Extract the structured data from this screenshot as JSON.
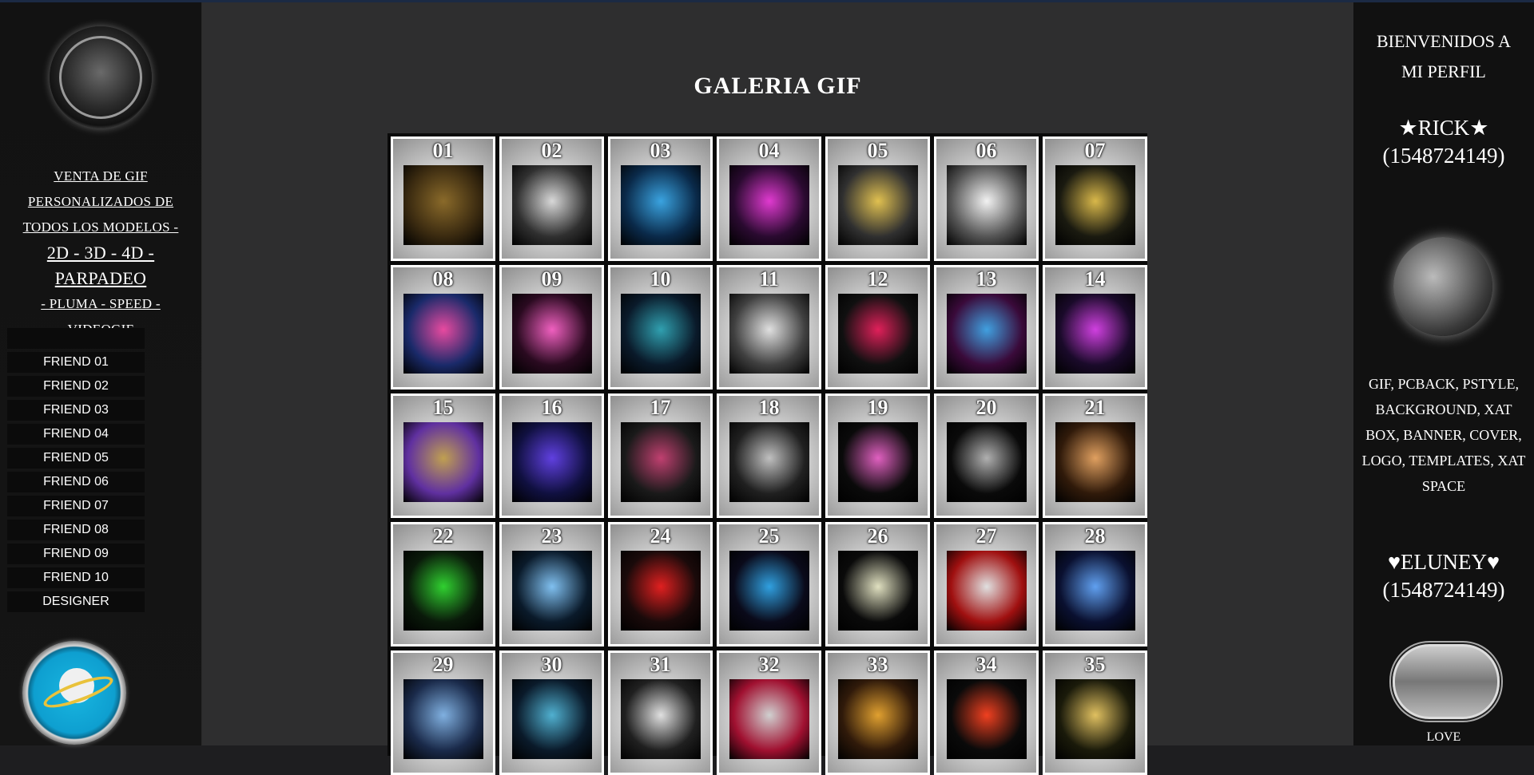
{
  "left": {
    "logo_icon": "rick-logo-icon",
    "promo": {
      "line1": "VENTA DE GIF",
      "line2": "PERSONALIZADOS DE",
      "line3": "TODOS LOS MODELOS -",
      "line4": "2D - 3D - 4D - PARPADEO",
      "line5": "- PLUMA - SPEED -",
      "line6": "VIDEOGIF"
    },
    "friends": [
      "FRIEND 01",
      "FRIEND 02",
      "FRIEND 03",
      "FRIEND 04",
      "FRIEND 05",
      "FRIEND 06",
      "FRIEND 07",
      "FRIEND 08",
      "FRIEND 09",
      "FRIEND 10",
      "DESIGNER"
    ],
    "bottom_icon": "saturn-icon"
  },
  "main": {
    "title": "GALERIA GIF",
    "tiles": [
      {
        "num": "01",
        "colors": [
          "#8a6a2a",
          "#3a2a10"
        ]
      },
      {
        "num": "02",
        "colors": [
          "#d8d8d8",
          "#303030"
        ]
      },
      {
        "num": "03",
        "colors": [
          "#3aa3e0",
          "#0a2a4a"
        ]
      },
      {
        "num": "04",
        "colors": [
          "#e03ad0",
          "#2a0a30"
        ]
      },
      {
        "num": "05",
        "colors": [
          "#e0c050",
          "#303030"
        ]
      },
      {
        "num": "06",
        "colors": [
          "#f2f2f2",
          "#555555"
        ]
      },
      {
        "num": "07",
        "colors": [
          "#d9b84a",
          "#1a1a10"
        ]
      },
      {
        "num": "08",
        "colors": [
          "#e84aa0",
          "#1a2a6a"
        ]
      },
      {
        "num": "09",
        "colors": [
          "#f060c0",
          "#2a0a20"
        ]
      },
      {
        "num": "10",
        "colors": [
          "#30a0b0",
          "#0a1a2a"
        ]
      },
      {
        "num": "11",
        "colors": [
          "#e0e0e0",
          "#404040"
        ]
      },
      {
        "num": "12",
        "colors": [
          "#e0205a",
          "#101010"
        ]
      },
      {
        "num": "13",
        "colors": [
          "#40a0e0",
          "#3a0a3a"
        ]
      },
      {
        "num": "14",
        "colors": [
          "#d040e0",
          "#1a0a2a"
        ]
      },
      {
        "num": "15",
        "colors": [
          "#c0a050",
          "#6030a0"
        ]
      },
      {
        "num": "16",
        "colors": [
          "#6040e0",
          "#101040"
        ]
      },
      {
        "num": "17",
        "colors": [
          "#c04070",
          "#1a1a1a"
        ]
      },
      {
        "num": "18",
        "colors": [
          "#c0c0c0",
          "#202020"
        ]
      },
      {
        "num": "19",
        "colors": [
          "#e060c0",
          "#0a0a0a"
        ]
      },
      {
        "num": "20",
        "colors": [
          "#b0b0b0",
          "#0a0a0a"
        ]
      },
      {
        "num": "21",
        "colors": [
          "#e0a060",
          "#301a0a"
        ]
      },
      {
        "num": "22",
        "colors": [
          "#30d030",
          "#0a1a0a"
        ]
      },
      {
        "num": "23",
        "colors": [
          "#80c0f0",
          "#0a1a2a"
        ]
      },
      {
        "num": "24",
        "colors": [
          "#e02020",
          "#1a0a0a"
        ]
      },
      {
        "num": "25",
        "colors": [
          "#30a0e0",
          "#0a0a1a"
        ]
      },
      {
        "num": "26",
        "colors": [
          "#e0e0c0",
          "#0a0a0a"
        ]
      },
      {
        "num": "27",
        "colors": [
          "#e0e0e0",
          "#a01010"
        ]
      },
      {
        "num": "28",
        "colors": [
          "#60a0f0",
          "#0a1030"
        ]
      },
      {
        "num": "29",
        "colors": [
          "#80b0e0",
          "#1a2a4a"
        ]
      },
      {
        "num": "30",
        "colors": [
          "#50b0d0",
          "#0a1a2a"
        ]
      },
      {
        "num": "31",
        "colors": [
          "#e0e0e0",
          "#202020"
        ]
      },
      {
        "num": "32",
        "colors": [
          "#d0d0d0",
          "#a01030"
        ]
      },
      {
        "num": "33",
        "colors": [
          "#e0a030",
          "#301a0a"
        ]
      },
      {
        "num": "34",
        "colors": [
          "#f04020",
          "#0a0a0a"
        ]
      },
      {
        "num": "35",
        "colors": [
          "#e0c060",
          "#1a1a0a"
        ]
      }
    ]
  },
  "right": {
    "welcome1": "BIENVENIDOS A",
    "welcome2": "MI PERFIL",
    "user1_name": "★RICK★",
    "user1_id": "(1548724149)",
    "avatar_icon": "rick-avatar-icon",
    "services": "GIF, PCBACK, PSTYLE, BACKGROUND, XAT BOX, BANNER, COVER, LOGO, TEMPLATES, XAT SPACE",
    "user2_name": "♥ELUNEY♥",
    "user2_id": "(1548724149)",
    "love_image_icon": "love-image-icon",
    "love_label": "LOVE"
  }
}
